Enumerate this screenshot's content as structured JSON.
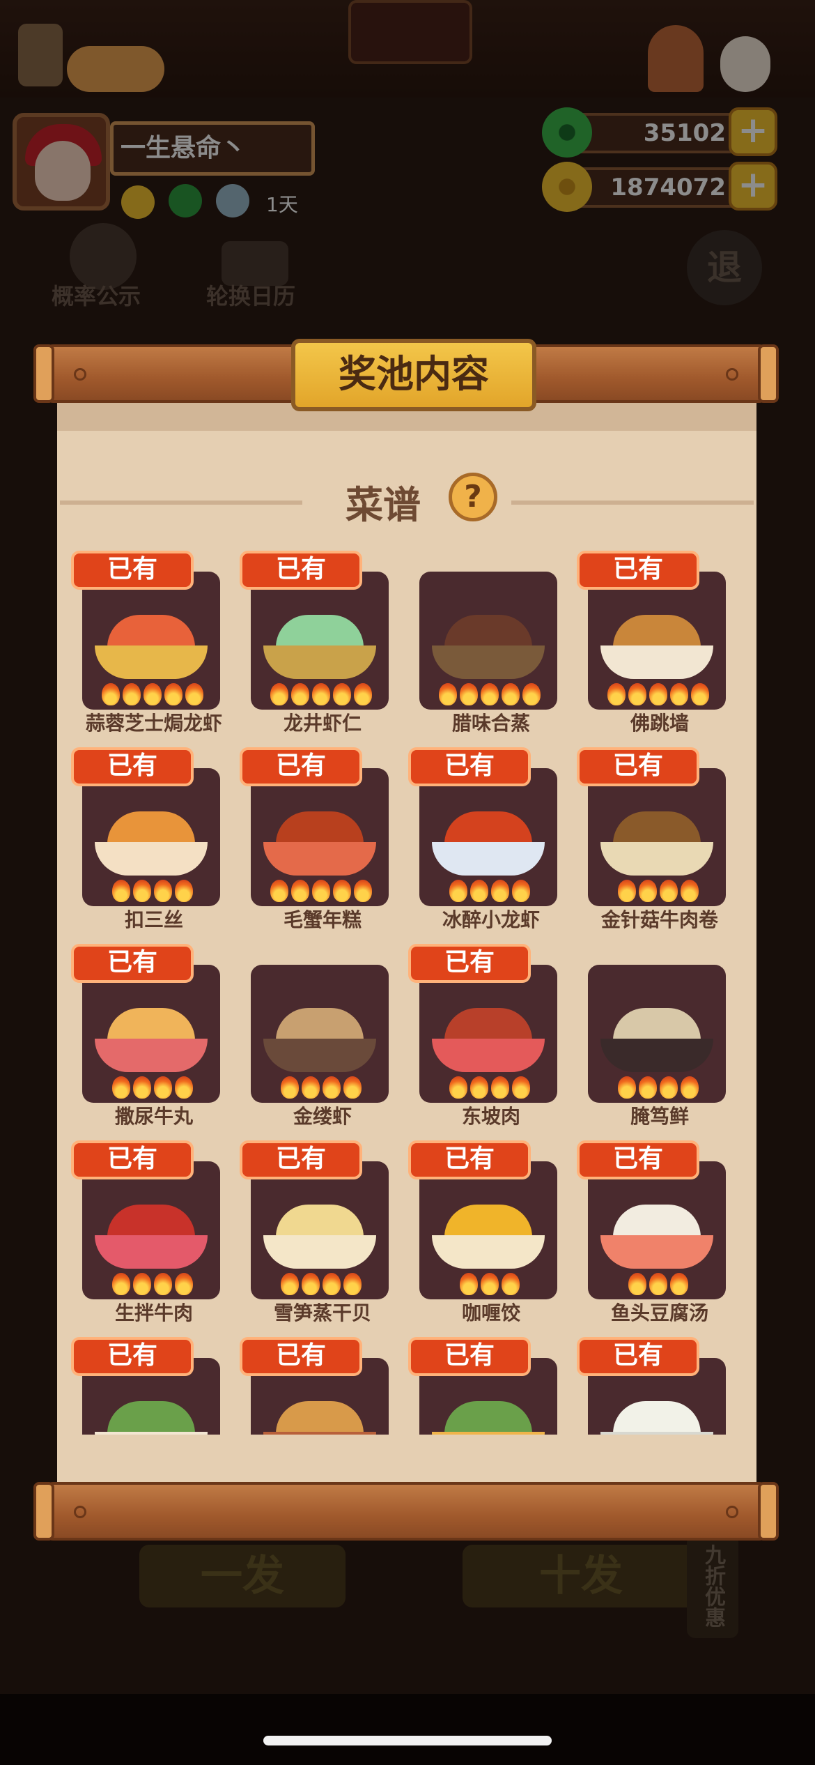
{
  "background": {
    "icons": [
      {
        "label": "概率公示",
        "name": "probability-icon"
      },
      {
        "label": "轮换日历",
        "name": "calendar-icon"
      },
      {
        "label": "退",
        "name": "exit-icon"
      }
    ],
    "buttons": [
      "一发",
      "十发",
      "九折优惠"
    ]
  },
  "header": {
    "player_name": "一生悬命丶",
    "days": "1天",
    "currencies": [
      {
        "name": "jade",
        "value": "35102",
        "color": "#3bb54a"
      },
      {
        "name": "coin",
        "value": "1874072",
        "color": "#f2c230"
      }
    ]
  },
  "modal": {
    "title": "奖池内容",
    "section_title": "菜谱",
    "help_label": "?",
    "owned_label": "已有",
    "dishes": [
      {
        "name": "蒜蓉芝士焗龙虾",
        "owned": true,
        "fires": 5,
        "food": "#e8623a",
        "bowl": "#e7b74a"
      },
      {
        "name": "龙井虾仁",
        "owned": true,
        "fires": 5,
        "food": "#8fd19a",
        "bowl": "#c9a24a"
      },
      {
        "name": "腊味合蒸",
        "owned": false,
        "fires": 5,
        "food": "#6a3a2a",
        "bowl": "#7a5a3a"
      },
      {
        "name": "佛跳墙",
        "owned": true,
        "fires": 5,
        "food": "#c9863a",
        "bowl": "#f2e6d2"
      },
      {
        "name": "扣三丝",
        "owned": true,
        "fires": 4,
        "food": "#e8943a",
        "bowl": "#f4e0c4"
      },
      {
        "name": "毛蟹年糕",
        "owned": true,
        "fires": 5,
        "food": "#b8401e",
        "bowl": "#e46a4a"
      },
      {
        "name": "冰醉小龙虾",
        "owned": true,
        "fires": 4,
        "food": "#d4421e",
        "bowl": "#dfe7f2"
      },
      {
        "name": "金针菇牛肉卷",
        "owned": true,
        "fires": 4,
        "food": "#8a5a2a",
        "bowl": "#e9d9b4"
      },
      {
        "name": "撒尿牛丸",
        "owned": true,
        "fires": 4,
        "food": "#f0b45a",
        "bowl": "#e46a6a"
      },
      {
        "name": "金缕虾",
        "owned": false,
        "fires": 4,
        "food": "#c8a070",
        "bowl": "#6a4a3a"
      },
      {
        "name": "东坡肉",
        "owned": true,
        "fires": 4,
        "food": "#b8402a",
        "bowl": "#e45a5a"
      },
      {
        "name": "腌笃鲜",
        "owned": false,
        "fires": 4,
        "food": "#d8c8a8",
        "bowl": "#3a2a2a"
      },
      {
        "name": "生拌牛肉",
        "owned": true,
        "fires": 4,
        "food": "#c8322a",
        "bowl": "#e45a6a"
      },
      {
        "name": "雪笋蒸干贝",
        "owned": true,
        "fires": 4,
        "food": "#f0d890",
        "bowl": "#f4e6c8"
      },
      {
        "name": "咖喱饺",
        "owned": true,
        "fires": 3,
        "food": "#f0b42a",
        "bowl": "#f4e6c8"
      },
      {
        "name": "鱼头豆腐汤",
        "owned": true,
        "fires": 3,
        "food": "#f2ece0",
        "bowl": "#f0826a"
      },
      {
        "name": "",
        "owned": true,
        "fires": 0,
        "food": "#6aa04a",
        "bowl": "#f2e6d2"
      },
      {
        "name": "",
        "owned": true,
        "fires": 0,
        "food": "#d89a4a",
        "bowl": "#b8603a"
      },
      {
        "name": "",
        "owned": true,
        "fires": 0,
        "food": "#6aa04a",
        "bowl": "#f0b44a"
      },
      {
        "name": "",
        "owned": true,
        "fires": 0,
        "food": "#f2f2e8",
        "bowl": "#d8d8d0"
      }
    ]
  }
}
